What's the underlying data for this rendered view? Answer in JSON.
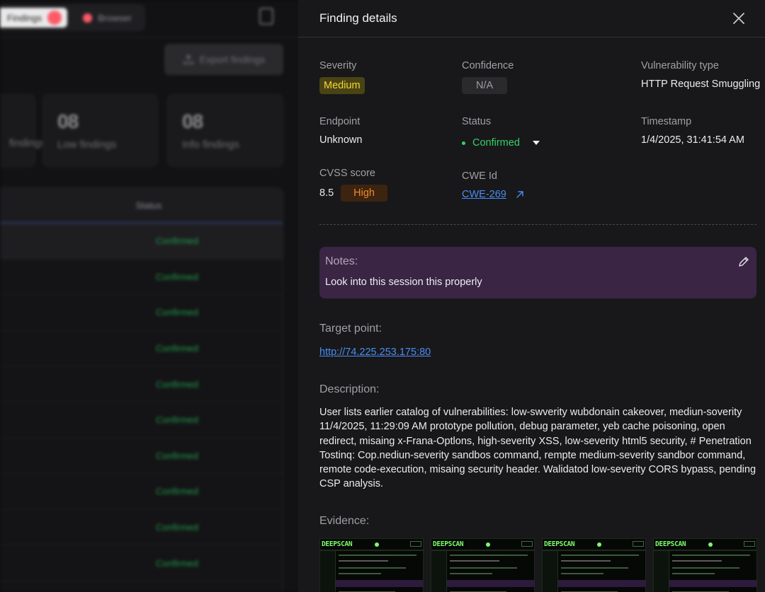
{
  "background": {
    "tab_active_label": "Findings",
    "tab_browser_label": "Browser",
    "export_label": "Export findings",
    "cards": [
      {
        "count": "",
        "label": "findings"
      },
      {
        "count": "08",
        "label": "Low findings"
      },
      {
        "count": "08",
        "label": "Info findings"
      }
    ],
    "table_header": "Status",
    "row_status": "Confirmed"
  },
  "panel": {
    "title": "Finding details",
    "severity": {
      "label": "Severity",
      "value": "Medium"
    },
    "confidence": {
      "label": "Confidence",
      "value": "N/A"
    },
    "vuln_type": {
      "label": "Vulnerability type",
      "value": "HTTP Request Smuggling"
    },
    "endpoint": {
      "label": "Endpoint",
      "value": "Unknown"
    },
    "status": {
      "label": "Status",
      "value": "Confirmed"
    },
    "timestamp": {
      "label": "Timestamp",
      "value": "1/4/2025, 31:41:54 AM"
    },
    "cvss": {
      "label": "CVSS score",
      "score": "8.5",
      "rating": "High"
    },
    "cwe": {
      "label": "CWE Id",
      "value": "CWE-269"
    },
    "notes": {
      "title": "Notes:",
      "text": "Look into this session this properly"
    },
    "target": {
      "title": "Target point:",
      "url": "http://74.225.253.175:80"
    },
    "description": {
      "title": "Description:",
      "text": "User lists earlier catalog of vulnerabilities: low-swverity wubdonain cakeover, mediun-soverity 11/4/2025, 11:29:09 AM prototype pollution, debug parameter, yeb cache poisoning, open redirect, misaing x-Frana-Optlons, high-severity XSS, low-severity html5 security, # Penetration Tostinq: Cop.nediun-severity sandbos command, rempte medium-severity sandbor command, remote code-execution, misaing security header. Walidatod low-severity CORS bypass, pending CSP analysis."
    },
    "evidence": {
      "title": "Evidence:",
      "brand": "DEEPSCAN"
    }
  },
  "colors": {
    "panel_bg": "#18181a",
    "medium": "#f3d836",
    "high": "#f08a2a",
    "confirmed": "#35d16a",
    "link": "#4a8cf2",
    "notes_bg": "#3a2545"
  },
  "icons": [
    "close-icon",
    "pencil-icon",
    "external-link-icon",
    "chevron-down-icon",
    "file-icon",
    "upload-icon"
  ]
}
